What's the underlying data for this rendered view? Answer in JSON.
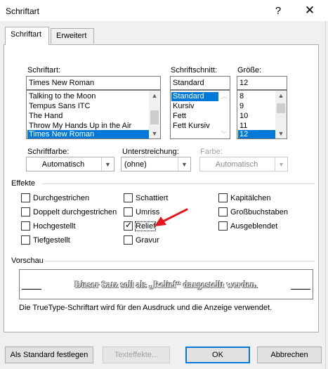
{
  "window": {
    "title": "Schriftart",
    "help_glyph": "?",
    "close_glyph": "✕"
  },
  "tabs": [
    {
      "label": "Schriftart",
      "active": true
    },
    {
      "label": "Erweitert",
      "active": false
    }
  ],
  "font": {
    "label": "Schriftart:",
    "value": "Times New Roman",
    "items": [
      "Talking to the Moon",
      "Tempus Sans ITC",
      "The Hand",
      "Throw My Hands Up in the Air",
      "Times New Roman"
    ],
    "selected": "Times New Roman"
  },
  "style": {
    "label": "Schriftschnitt:",
    "value": "Standard",
    "items": [
      "Standard",
      "Kursiv",
      "Fett",
      "Fett Kursiv"
    ],
    "selected": "Standard"
  },
  "size": {
    "label": "Größe:",
    "value": "12",
    "items": [
      "8",
      "9",
      "10",
      "11",
      "12"
    ],
    "selected": "12"
  },
  "font_color": {
    "label": "Schriftfarbe:",
    "value": "Automatisch"
  },
  "underline": {
    "label": "Unterstreichung:",
    "value": "(ohne)"
  },
  "underline_color": {
    "label": "Farbe:",
    "value": "Automatisch",
    "disabled": true
  },
  "effects": {
    "heading": "Effekte",
    "items": {
      "strikethrough": {
        "label": "Durchgestrichen",
        "checked": false
      },
      "double_strikethrough": {
        "label": "Doppelt durchgestrichen",
        "checked": false
      },
      "superscript": {
        "label": "Hochgestellt",
        "checked": false
      },
      "subscript": {
        "label": "Tiefgestellt",
        "checked": false
      },
      "shadow": {
        "label": "Schattiert",
        "checked": false
      },
      "outline": {
        "label": "Umriss",
        "checked": false
      },
      "emboss": {
        "label": "Relief",
        "checked": true
      },
      "engrave": {
        "label": "Gravur",
        "checked": false
      },
      "small_caps": {
        "label": "Kapitälchen",
        "checked": false
      },
      "all_caps": {
        "label": "Großbuchstaben",
        "checked": false
      },
      "hidden": {
        "label": "Ausgeblendet",
        "checked": false
      }
    }
  },
  "preview": {
    "heading": "Vorschau",
    "sample": "Dieser Satz soll als „Relief“ dargestellt werden.",
    "note": "Die TrueType-Schriftart wird für den Ausdruck und die Anzeige verwendet."
  },
  "buttons": {
    "set_default": "Als Standard festlegen",
    "text_effects": "Texteffekte...",
    "ok": "OK",
    "cancel": "Abbrechen"
  },
  "colors": {
    "selection": "#0078d7",
    "annotation_arrow": "#e8141c",
    "dialog_bg": "#f0f0f0"
  }
}
